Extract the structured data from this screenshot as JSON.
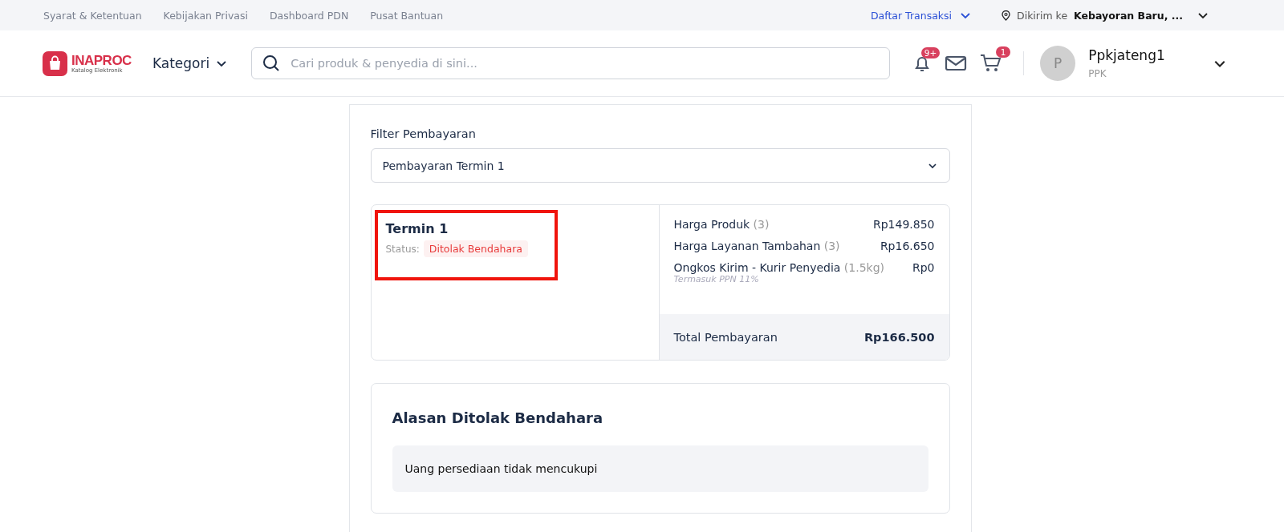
{
  "top_links": [
    "Syarat & Ketentuan",
    "Kebijakan Privasi",
    "Dashboard PDN",
    "Pusat Bantuan"
  ],
  "top_right": {
    "transactions": "Daftar Transaksi",
    "ship_label": "Dikirim ke",
    "ship_location": "Kebayoran Baru, ..."
  },
  "header": {
    "logo_name": "INAPROC",
    "logo_sub": "Katalog Elektronik",
    "category": "Kategori",
    "search": {
      "placeholder": "Cari produk & penyedia di sini..."
    },
    "notification_badge": "9+",
    "cart_badge": "1",
    "user": {
      "initial": "P",
      "name": "Ppkjateng1",
      "role": "PPK"
    }
  },
  "filter": {
    "label": "Filter Pembayaran",
    "value": "Pembayaran Termin 1"
  },
  "termin": {
    "title": "Termin 1",
    "status_label": "Status:",
    "status": "Ditolak Bendahara",
    "highlighted": true
  },
  "prices": [
    {
      "label": "Harga Produk",
      "qualifier": "(3)",
      "value": "Rp149.850"
    },
    {
      "label": "Harga Layanan Tambahan",
      "qualifier": "(3)",
      "value": "Rp16.650"
    },
    {
      "label": "Ongkos Kirim - Kurir Penyedia",
      "qualifier": "(1.5kg)",
      "value": "Rp0",
      "note": "Termasuk PPN 11%"
    }
  ],
  "total": {
    "label": "Total Pembayaran",
    "value": "Rp166.500"
  },
  "reason": {
    "title": "Alasan Ditolak Bendahara",
    "text": "Uang persediaan tidak mencukupi"
  }
}
